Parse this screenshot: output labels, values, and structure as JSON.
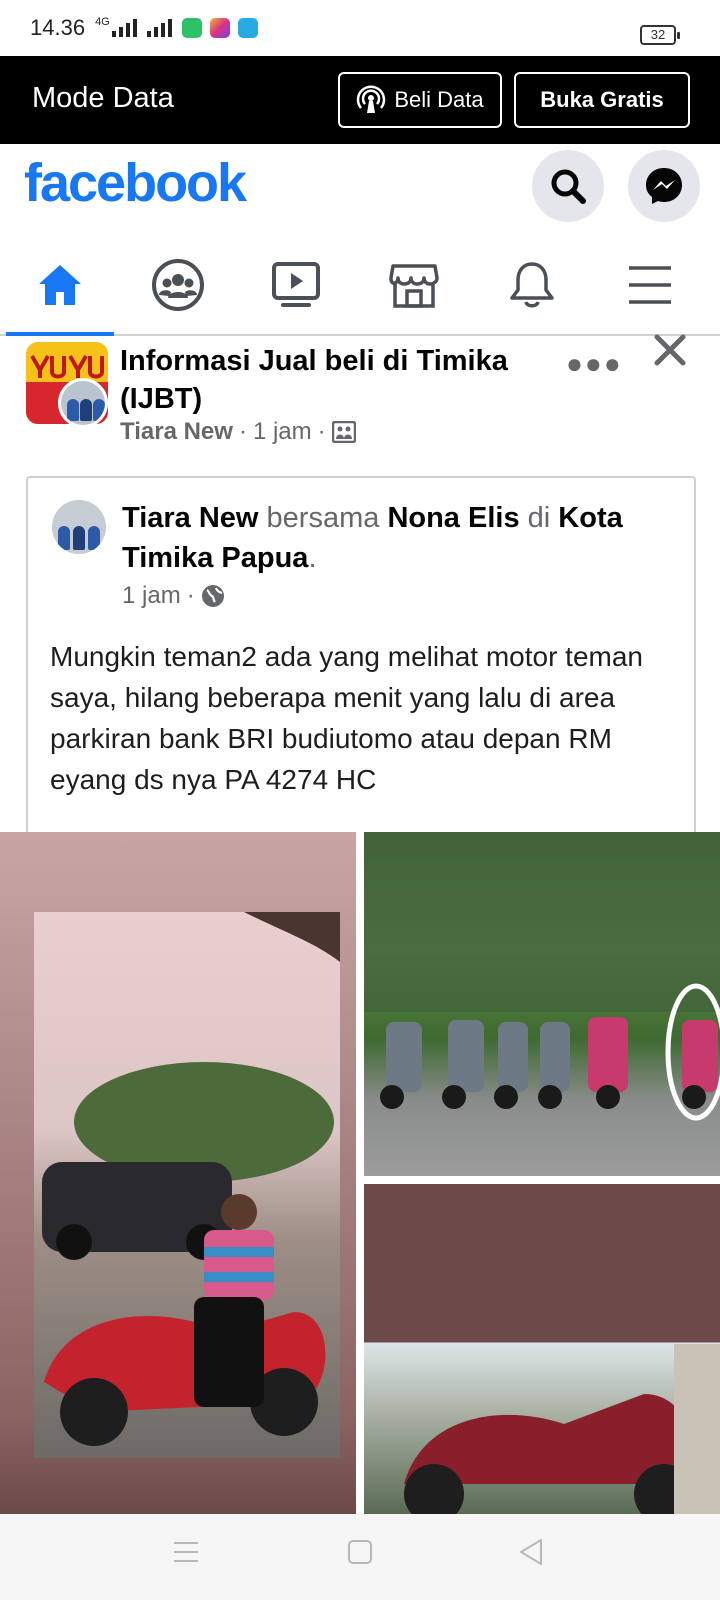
{
  "status_bar": {
    "time": "14.36",
    "network": "4G",
    "battery": "32"
  },
  "mode_bar": {
    "title": "Mode Data",
    "beli_label": "Beli Data",
    "buka_label": "Buka Gratis"
  },
  "header": {
    "logo": "facebook"
  },
  "nav": {
    "icons": [
      "home-icon",
      "groups-icon",
      "video-icon",
      "marketplace-icon",
      "bell-icon",
      "menu-icon"
    ],
    "active_index": 0
  },
  "post": {
    "group_name": "Informasi Jual beli di Timika (IJBT)",
    "author": "Tiara New",
    "separator": "·",
    "time": "1 jam",
    "shared": {
      "author": "Tiara New",
      "with_word": "bersama",
      "tagged": "Nona Elis",
      "at_word": "di",
      "location": "Kota Timika Papua",
      "time": "1 jam",
      "text": "Mungkin teman2 ada yang melihat motor teman saya, hilang beberapa menit yang lalu di area parkiran bank BRI budiutomo atau depan RM eyang ds nya PA 4274 HC"
    }
  },
  "colors": {
    "brand": "#1877f2",
    "secondary_text": "#65676b",
    "nav_icon": "#4b4f56"
  }
}
